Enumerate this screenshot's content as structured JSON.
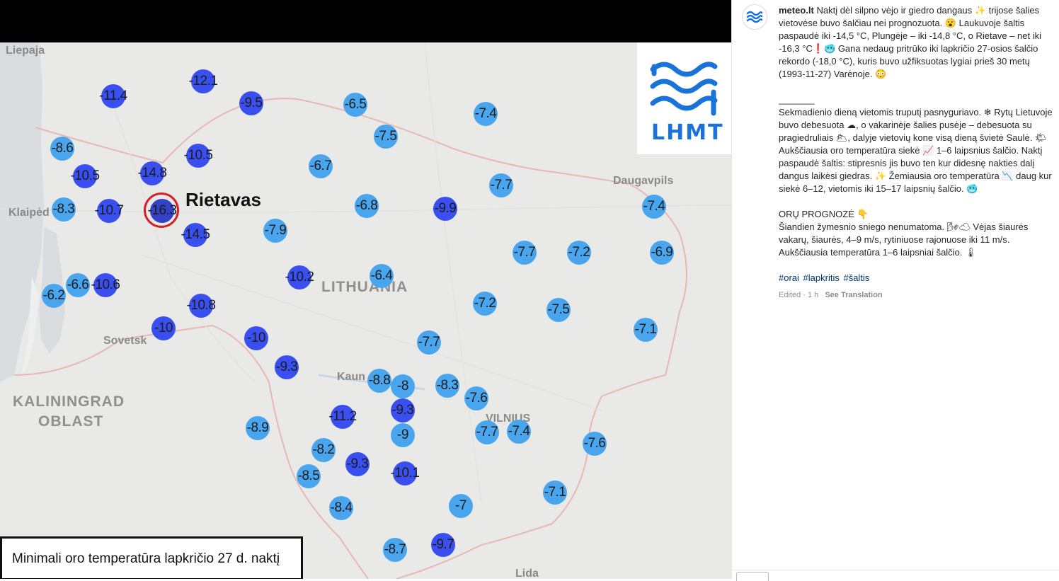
{
  "map": {
    "logo_text": "LHMT",
    "highlight_label": "Rietavas",
    "caption": "Minimali oro temperatūra lapkričio 27 d. naktį",
    "places": [
      {
        "name": "Liepaja"
      },
      {
        "name": "Klaipėd"
      },
      {
        "name": "Sovetsk"
      },
      {
        "name": "Kaun"
      },
      {
        "name": "VILNIUS"
      },
      {
        "name": "Daugavpils"
      },
      {
        "name": "Lida"
      }
    ],
    "regions": [
      {
        "name": "LITHUANIA"
      },
      {
        "name": "KALININGRAD"
      },
      {
        "name": "OBLAST"
      }
    ],
    "stations": [
      {
        "value": "-12.1",
        "tone": "dark"
      },
      {
        "value": "-11.4",
        "tone": "dark"
      },
      {
        "value": "-9.5",
        "tone": "dark"
      },
      {
        "value": "-6.5",
        "tone": "light"
      },
      {
        "value": "-7.4",
        "tone": "light"
      },
      {
        "value": "-7.5",
        "tone": "light"
      },
      {
        "value": "-8.6",
        "tone": "light"
      },
      {
        "value": "-10.5",
        "tone": "dark"
      },
      {
        "value": "-10.5",
        "tone": "dark"
      },
      {
        "value": "-14.8",
        "tone": "dark"
      },
      {
        "value": "-6.7",
        "tone": "light"
      },
      {
        "value": "-7.7",
        "tone": "light"
      },
      {
        "value": "-8.3",
        "tone": "light"
      },
      {
        "value": "-10.7",
        "tone": "dark"
      },
      {
        "value": "-16.3",
        "tone": "extreme"
      },
      {
        "value": "-6.8",
        "tone": "light"
      },
      {
        "value": "-9.9",
        "tone": "dark"
      },
      {
        "value": "-7.4",
        "tone": "light"
      },
      {
        "value": "-14.5",
        "tone": "dark"
      },
      {
        "value": "-7.9",
        "tone": "light"
      },
      {
        "value": "-7.7",
        "tone": "light"
      },
      {
        "value": "-7.2",
        "tone": "light"
      },
      {
        "value": "-6.9",
        "tone": "light"
      },
      {
        "value": "-10.2",
        "tone": "dark"
      },
      {
        "value": "-6.4",
        "tone": "light"
      },
      {
        "value": "-6.6",
        "tone": "light"
      },
      {
        "value": "-10.6",
        "tone": "dark"
      },
      {
        "value": "-6.2",
        "tone": "light"
      },
      {
        "value": "-10.8",
        "tone": "dark"
      },
      {
        "value": "-7.2",
        "tone": "light"
      },
      {
        "value": "-7.5",
        "tone": "light"
      },
      {
        "value": "-10",
        "tone": "dark"
      },
      {
        "value": "-10",
        "tone": "dark"
      },
      {
        "value": "-7.1",
        "tone": "light"
      },
      {
        "value": "-7.7",
        "tone": "light"
      },
      {
        "value": "-9.3",
        "tone": "dark"
      },
      {
        "value": "-8.8",
        "tone": "light"
      },
      {
        "value": "-8",
        "tone": "light"
      },
      {
        "value": "-8.3",
        "tone": "light"
      },
      {
        "value": "-7.6",
        "tone": "light"
      },
      {
        "value": "-11.2",
        "tone": "dark"
      },
      {
        "value": "-9.3",
        "tone": "dark"
      },
      {
        "value": "-8.9",
        "tone": "light"
      },
      {
        "value": "-9",
        "tone": "light"
      },
      {
        "value": "-7.7",
        "tone": "light"
      },
      {
        "value": "-7.4",
        "tone": "light"
      },
      {
        "value": "-7.6",
        "tone": "light"
      },
      {
        "value": "-8.2",
        "tone": "light"
      },
      {
        "value": "-9.3",
        "tone": "dark"
      },
      {
        "value": "-8.5",
        "tone": "light"
      },
      {
        "value": "-10.1",
        "tone": "dark"
      },
      {
        "value": "-7.1",
        "tone": "light"
      },
      {
        "value": "-8.4",
        "tone": "light"
      },
      {
        "value": "-7",
        "tone": "light"
      },
      {
        "value": "-8.7",
        "tone": "light"
      },
      {
        "value": "-9.7",
        "tone": "dark"
      }
    ]
  },
  "colors": {
    "light_station": "#49a6ee",
    "dark_station": "#3a4ff0",
    "extreme_station": "#3343c8",
    "highlight_ring": "#d3202a",
    "logo": "#1a73d9"
  },
  "post": {
    "username": "meteo.lt",
    "para1": "Naktį dėl silpno vėjo ir giedro dangaus ✨ trijose šalies vietovėse buvo šalčiau nei prognozuota. 😮 Laukuvoje šaltis paspaudė iki -14,5 °C, Plungėje – iki -14,8 °C, o Rietave – net iki -16,3 °C❗🥶 Gana nedaug pritrūko iki lapkričio 27-osios šalčio rekordo (-18,0 °C), kuris buvo užfiksuotas lygiai prieš 30 metų (1993-11-27) Varėnoje. 😳",
    "divider": "_______",
    "para2": "Sekmadienio dieną vietomis truputį pasnyguriavo. ❄ Rytų Lietuvoje buvo debesuota ☁, o vakarinėje šalies pusėje – debesuota su pragiedruliais 🌥, dalyje vietovių kone visą dieną švietė Saulė. 🌤 Aukščiausia oro temperatūra siekė 📈 1–6 laipsnius šalčio. Naktį paspaudė šaltis: stipresnis jis buvo ten kur didesnę nakties dalį dangus laikėsi giedras. ✨ Žemiausia oro temperatūra 📉 daug kur siekė 6–12, vietomis iki 15–17 laipsnių šalčio. 🥶",
    "para3_title": "ORŲ PROGNOZĖ 👇",
    "para3": "Šiandien žymesnio sniego nenumatoma. 🌬☁ Vėjas šiaurės vakarų, šiaurės, 4–9 m/s, rytiniuose rajonuose iki 11 m/s. Aukščiausia temperatūra 1–6 laipsniai šalčio. 🌡",
    "hashtags": [
      "#orai",
      "#lapkritis",
      "#šaltis"
    ],
    "edited": "Edited · 1 h",
    "see_translation": "See Translation"
  }
}
